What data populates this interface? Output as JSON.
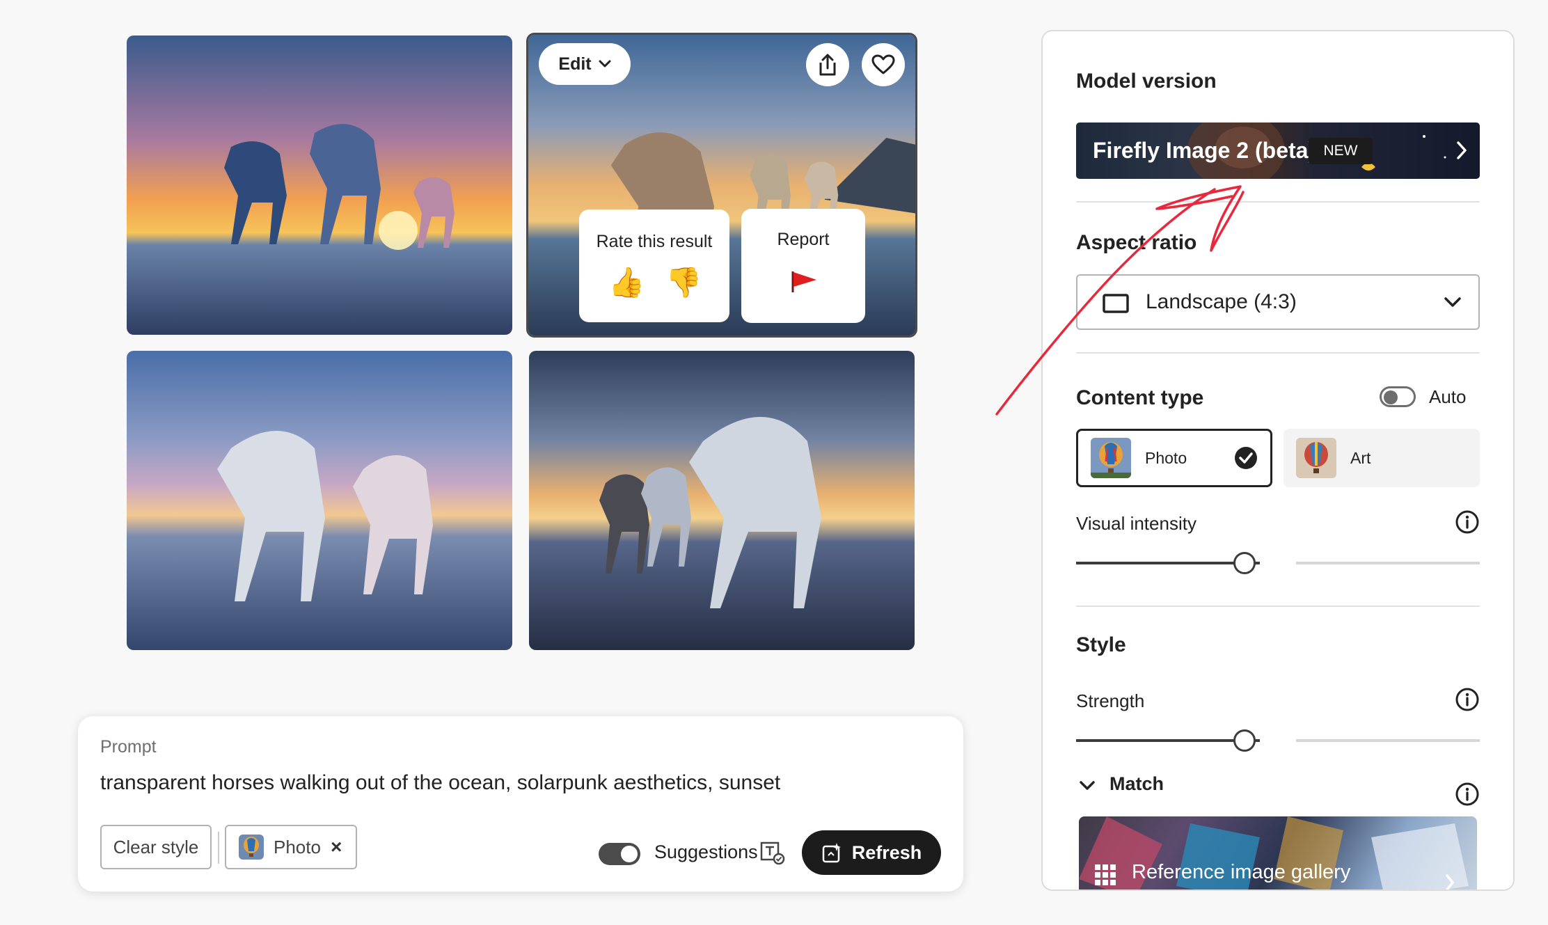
{
  "grid": {
    "tile1_alt": "",
    "tile2": {
      "edit_label": "Edit",
      "rate_title": "Rate this result",
      "thumbs_up": "👍",
      "thumbs_down": "👎",
      "report_title": "Report"
    }
  },
  "prompt": {
    "label": "Prompt",
    "text": "transparent horses walking out of the ocean, solarpunk aesthetics, sunset",
    "clear_style": "Clear style",
    "photo_chip": "Photo",
    "photo_chip_remove": "×",
    "suggestions_label": "Suggestions",
    "suggestions_on": true,
    "refresh_label": "Refresh"
  },
  "panel": {
    "model_version": {
      "title": "Model version",
      "model_name": "Firefly Image 2 (beta)",
      "badge": "NEW"
    },
    "aspect_ratio": {
      "title": "Aspect ratio",
      "value": "Landscape (4:3)"
    },
    "content_type": {
      "title": "Content type",
      "auto_label": "Auto",
      "auto_on": false,
      "options": [
        {
          "label": "Photo",
          "selected": true
        },
        {
          "label": "Art",
          "selected": false
        }
      ],
      "visual_intensity_label": "Visual intensity",
      "visual_intensity_value": 0.5
    },
    "style": {
      "title": "Style",
      "strength_label": "Strength",
      "strength_value": 0.5,
      "match_label": "Match",
      "reference_gallery_label": "Reference image gallery"
    }
  },
  "colors": {
    "annotation": "#e8283c",
    "accent_dark": "#1c1c1c"
  }
}
